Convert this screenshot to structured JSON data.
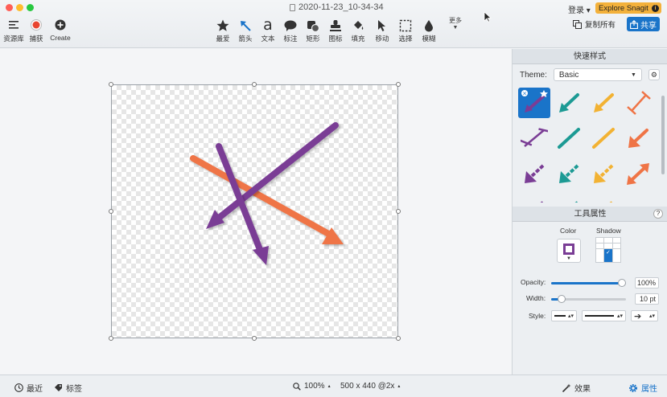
{
  "window": {
    "title": "2020-11-23_10-34-34",
    "traffic_colors": [
      "#ff5f57",
      "#febc2e",
      "#28c840"
    ]
  },
  "left_tools": [
    {
      "label": "资源库",
      "icon": "hamburger-icon"
    },
    {
      "label": "捕获",
      "icon": "record-icon"
    },
    {
      "label": "Create",
      "icon": "plus-circle-icon"
    }
  ],
  "tools": [
    {
      "label": "最爱",
      "icon": "star-icon"
    },
    {
      "label": "箭头",
      "icon": "arrow-icon"
    },
    {
      "label": "文本",
      "icon": "text-icon"
    },
    {
      "label": "标注",
      "icon": "callout-icon"
    },
    {
      "label": "矩形",
      "icon": "shape-icon"
    },
    {
      "label": "图标",
      "icon": "stamp-icon"
    },
    {
      "label": "填充",
      "icon": "fill-icon"
    },
    {
      "label": "移动",
      "icon": "move-icon"
    },
    {
      "label": "选择",
      "icon": "selection-icon"
    },
    {
      "label": "模糊",
      "icon": "blur-icon"
    }
  ],
  "more_label": "更多",
  "header_right": {
    "login": "登录 ▾",
    "explore": "Explore Snagit",
    "copy_all": "复制所有",
    "share": "共享"
  },
  "panel": {
    "quick_styles_title": "快速样式",
    "theme_label": "Theme:",
    "theme_value": "Basic",
    "tool_props_title": "工具属性",
    "color_label": "Color",
    "shadow_label": "Shadow",
    "opacity_label": "Opacity:",
    "opacity_value": "100%",
    "opacity_fraction": 1.0,
    "width_label": "Width:",
    "width_value": "10 pt",
    "width_fraction": 0.1,
    "style_label": "Style:",
    "accent": "#1a74c9",
    "arrow_color": "#7a3d95"
  },
  "canvas": {
    "arrow_colors": [
      "#ef7446",
      "#7a3d95"
    ]
  },
  "statusbar": {
    "recent": "最近",
    "tags": "标签",
    "zoom": "100%",
    "dimensions": "500 x 440 @2x",
    "effects": "效果",
    "properties": "属性"
  }
}
